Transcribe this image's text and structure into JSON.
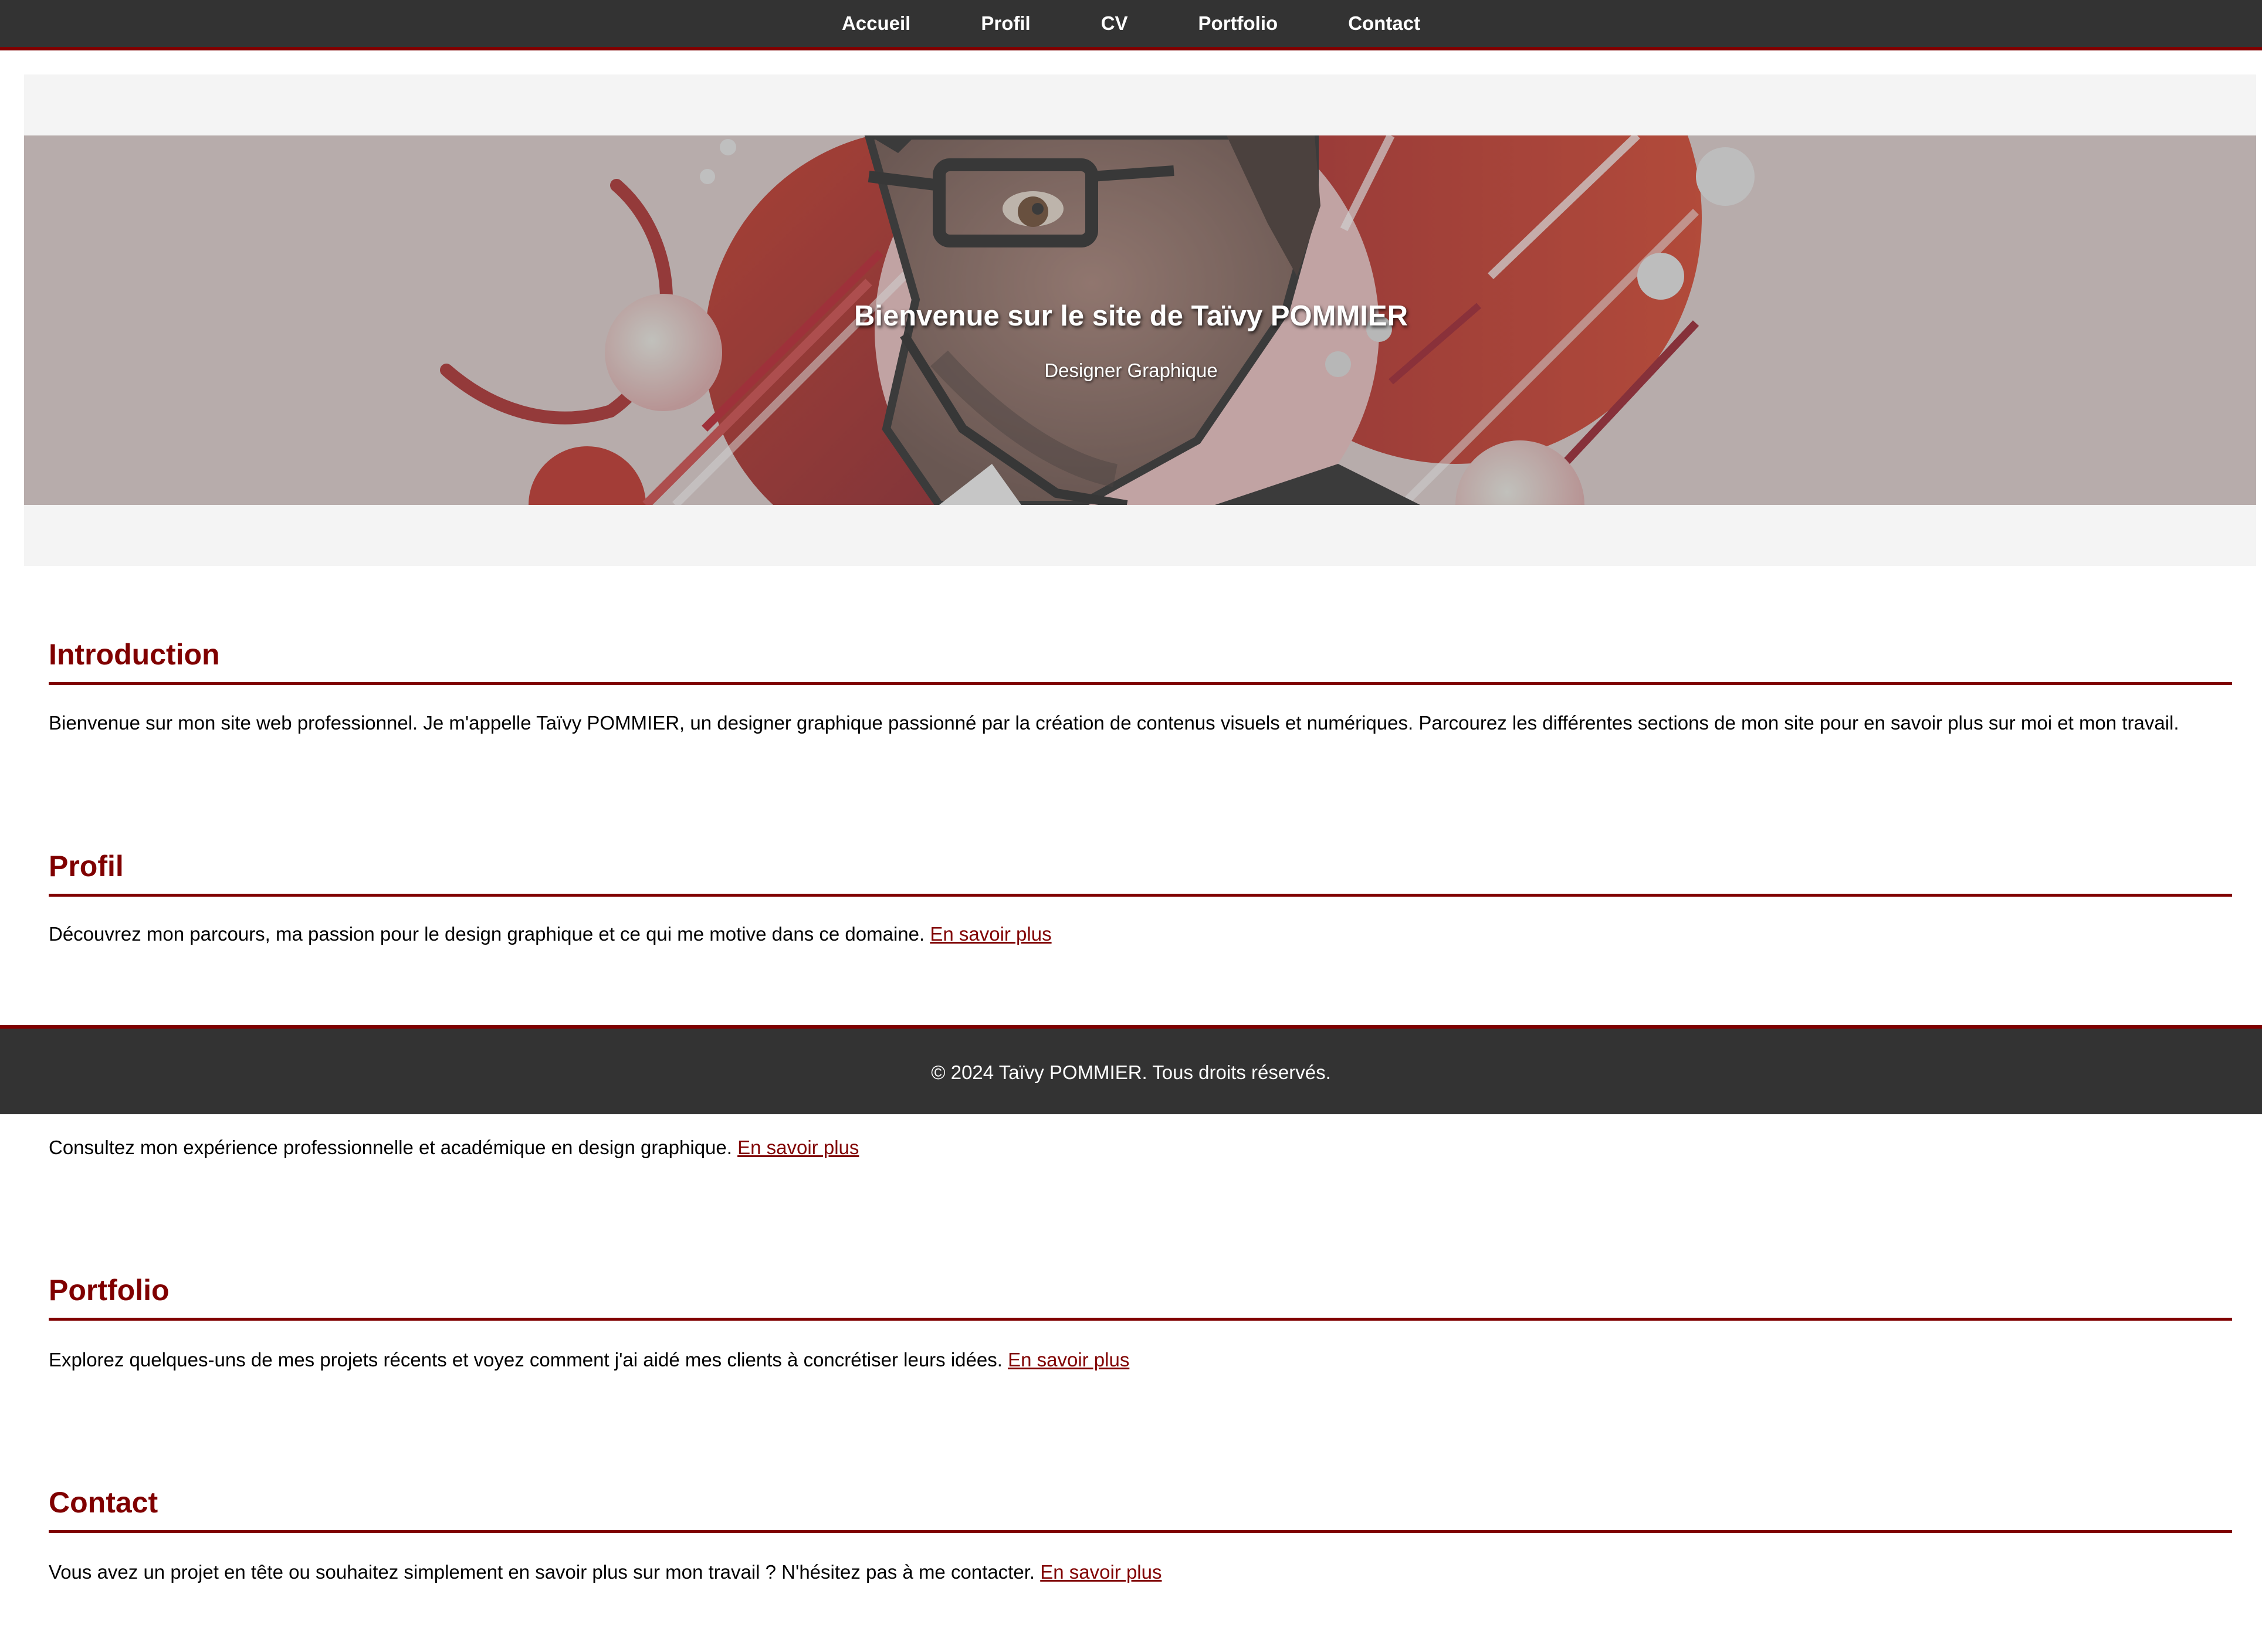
{
  "nav": {
    "items": [
      {
        "label": "Accueil"
      },
      {
        "label": "Profil"
      },
      {
        "label": "CV"
      },
      {
        "label": "Portfolio"
      },
      {
        "label": "Contact"
      }
    ]
  },
  "hero": {
    "title": "Bienvenue sur le site de Taïvy POMMIER",
    "subtitle": "Designer Graphique"
  },
  "sections": {
    "introduction": {
      "title": "Introduction",
      "text": "Bienvenue sur mon site web professionnel. Je m'appelle Taïvy POMMIER, un designer graphique passionné par la création de contenus visuels et numériques. Parcourez les différentes sections de mon site pour en savoir plus sur moi et mon travail."
    },
    "profil": {
      "title": "Profil",
      "text": "Découvrez mon parcours, ma passion pour le design graphique et ce qui me motive dans ce domaine.",
      "link": "En savoir plus"
    },
    "cv": {
      "text": "Consultez mon expérience professionnelle et académique en design graphique.",
      "link": "En savoir plus"
    },
    "portfolio": {
      "title": "Portfolio",
      "text": "Explorez quelques-uns de mes projets récents et voyez comment j'ai aidé mes clients à concrétiser leurs idées.",
      "link": "En savoir plus"
    },
    "contact": {
      "title": "Contact",
      "text": "Vous avez un projet en tête ou souhaitez simplement en savoir plus sur mon travail ? N'hésitez pas à me contacter.",
      "link": "En savoir plus"
    }
  },
  "footer": {
    "text": "© 2024 Taïvy POMMIER. Tous droits réservés."
  },
  "colors": {
    "accent": "#800000",
    "nav_bg": "#333333",
    "hero_bg": "#f4f4f4"
  },
  "icons": {
    "hero_image": "illustrated-portrait-with-glasses"
  }
}
